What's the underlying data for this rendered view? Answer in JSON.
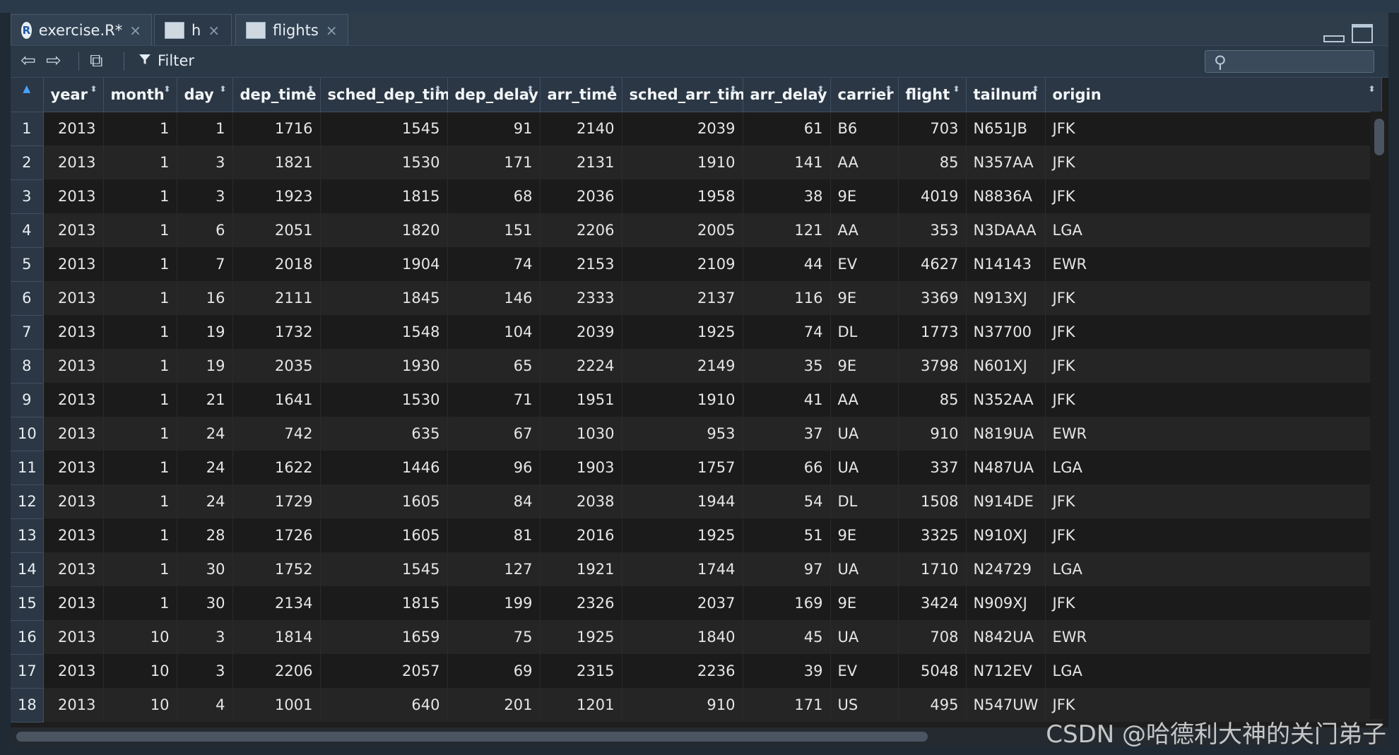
{
  "tabs": [
    {
      "label": "exercise.R*",
      "icon": "r-script-icon",
      "close": "×"
    },
    {
      "label": "h",
      "icon": "data-grid-icon",
      "close": "×"
    },
    {
      "label": "flights",
      "icon": "data-grid-icon",
      "close": "×"
    }
  ],
  "toolbar": {
    "back_icon": "⇦",
    "forward_icon": "⇨",
    "popout_icon": "⧉",
    "filter_label": "Filter",
    "search_placeholder": ""
  },
  "table": {
    "index_sort_icon": "▲",
    "sort_icon": "⬍",
    "columns": [
      "year",
      "month",
      "day",
      "dep_time",
      "sched_dep_time",
      "dep_delay",
      "arr_time",
      "sched_arr_time",
      "arr_delay",
      "carrier",
      "flight",
      "tailnum",
      "origin"
    ],
    "rows": [
      [
        "1",
        "2013",
        "1",
        "1",
        "1716",
        "1545",
        "91",
        "2140",
        "2039",
        "61",
        "B6",
        "703",
        "N651JB",
        "JFK"
      ],
      [
        "2",
        "2013",
        "1",
        "3",
        "1821",
        "1530",
        "171",
        "2131",
        "1910",
        "141",
        "AA",
        "85",
        "N357AA",
        "JFK"
      ],
      [
        "3",
        "2013",
        "1",
        "3",
        "1923",
        "1815",
        "68",
        "2036",
        "1958",
        "38",
        "9E",
        "4019",
        "N8836A",
        "JFK"
      ],
      [
        "4",
        "2013",
        "1",
        "6",
        "2051",
        "1820",
        "151",
        "2206",
        "2005",
        "121",
        "AA",
        "353",
        "N3DAAA",
        "LGA"
      ],
      [
        "5",
        "2013",
        "1",
        "7",
        "2018",
        "1904",
        "74",
        "2153",
        "2109",
        "44",
        "EV",
        "4627",
        "N14143",
        "EWR"
      ],
      [
        "6",
        "2013",
        "1",
        "16",
        "2111",
        "1845",
        "146",
        "2333",
        "2137",
        "116",
        "9E",
        "3369",
        "N913XJ",
        "JFK"
      ],
      [
        "7",
        "2013",
        "1",
        "19",
        "1732",
        "1548",
        "104",
        "2039",
        "1925",
        "74",
        "DL",
        "1773",
        "N37700",
        "JFK"
      ],
      [
        "8",
        "2013",
        "1",
        "19",
        "2035",
        "1930",
        "65",
        "2224",
        "2149",
        "35",
        "9E",
        "3798",
        "N601XJ",
        "JFK"
      ],
      [
        "9",
        "2013",
        "1",
        "21",
        "1641",
        "1530",
        "71",
        "1951",
        "1910",
        "41",
        "AA",
        "85",
        "N352AA",
        "JFK"
      ],
      [
        "10",
        "2013",
        "1",
        "24",
        "742",
        "635",
        "67",
        "1030",
        "953",
        "37",
        "UA",
        "910",
        "N819UA",
        "EWR"
      ],
      [
        "11",
        "2013",
        "1",
        "24",
        "1622",
        "1446",
        "96",
        "1903",
        "1757",
        "66",
        "UA",
        "337",
        "N487UA",
        "LGA"
      ],
      [
        "12",
        "2013",
        "1",
        "24",
        "1729",
        "1605",
        "84",
        "2038",
        "1944",
        "54",
        "DL",
        "1508",
        "N914DE",
        "JFK"
      ],
      [
        "13",
        "2013",
        "1",
        "28",
        "1726",
        "1605",
        "81",
        "2016",
        "1925",
        "51",
        "9E",
        "3325",
        "N910XJ",
        "JFK"
      ],
      [
        "14",
        "2013",
        "1",
        "30",
        "1752",
        "1545",
        "127",
        "1921",
        "1744",
        "97",
        "UA",
        "1710",
        "N24729",
        "LGA"
      ],
      [
        "15",
        "2013",
        "1",
        "30",
        "2134",
        "1815",
        "199",
        "2326",
        "2037",
        "169",
        "9E",
        "3424",
        "N909XJ",
        "JFK"
      ],
      [
        "16",
        "2013",
        "10",
        "3",
        "1814",
        "1659",
        "75",
        "1925",
        "1840",
        "45",
        "UA",
        "708",
        "N842UA",
        "EWR"
      ],
      [
        "17",
        "2013",
        "10",
        "3",
        "2206",
        "2057",
        "69",
        "2315",
        "2236",
        "39",
        "EV",
        "5048",
        "N712EV",
        "LGA"
      ],
      [
        "18",
        "2013",
        "10",
        "4",
        "1001",
        "640",
        "201",
        "1201",
        "910",
        "171",
        "US",
        "495",
        "N547UW",
        "JFK"
      ]
    ]
  },
  "watermark": "CSDN @哈德利大神的关门弟子"
}
